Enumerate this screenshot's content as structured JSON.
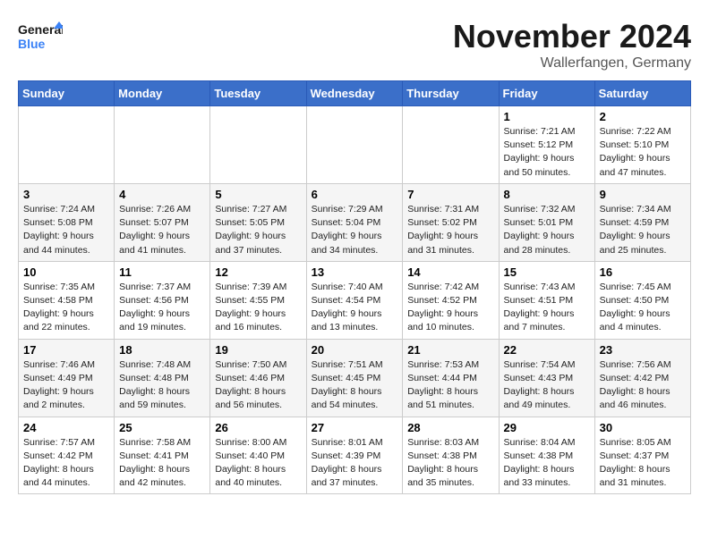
{
  "header": {
    "logo_line1": "General",
    "logo_line2": "Blue",
    "month": "November 2024",
    "location": "Wallerfangen, Germany"
  },
  "weekdays": [
    "Sunday",
    "Monday",
    "Tuesday",
    "Wednesday",
    "Thursday",
    "Friday",
    "Saturday"
  ],
  "weeks": [
    [
      {
        "day": "",
        "info": ""
      },
      {
        "day": "",
        "info": ""
      },
      {
        "day": "",
        "info": ""
      },
      {
        "day": "",
        "info": ""
      },
      {
        "day": "",
        "info": ""
      },
      {
        "day": "1",
        "info": "Sunrise: 7:21 AM\nSunset: 5:12 PM\nDaylight: 9 hours\nand 50 minutes."
      },
      {
        "day": "2",
        "info": "Sunrise: 7:22 AM\nSunset: 5:10 PM\nDaylight: 9 hours\nand 47 minutes."
      }
    ],
    [
      {
        "day": "3",
        "info": "Sunrise: 7:24 AM\nSunset: 5:08 PM\nDaylight: 9 hours\nand 44 minutes."
      },
      {
        "day": "4",
        "info": "Sunrise: 7:26 AM\nSunset: 5:07 PM\nDaylight: 9 hours\nand 41 minutes."
      },
      {
        "day": "5",
        "info": "Sunrise: 7:27 AM\nSunset: 5:05 PM\nDaylight: 9 hours\nand 37 minutes."
      },
      {
        "day": "6",
        "info": "Sunrise: 7:29 AM\nSunset: 5:04 PM\nDaylight: 9 hours\nand 34 minutes."
      },
      {
        "day": "7",
        "info": "Sunrise: 7:31 AM\nSunset: 5:02 PM\nDaylight: 9 hours\nand 31 minutes."
      },
      {
        "day": "8",
        "info": "Sunrise: 7:32 AM\nSunset: 5:01 PM\nDaylight: 9 hours\nand 28 minutes."
      },
      {
        "day": "9",
        "info": "Sunrise: 7:34 AM\nSunset: 4:59 PM\nDaylight: 9 hours\nand 25 minutes."
      }
    ],
    [
      {
        "day": "10",
        "info": "Sunrise: 7:35 AM\nSunset: 4:58 PM\nDaylight: 9 hours\nand 22 minutes."
      },
      {
        "day": "11",
        "info": "Sunrise: 7:37 AM\nSunset: 4:56 PM\nDaylight: 9 hours\nand 19 minutes."
      },
      {
        "day": "12",
        "info": "Sunrise: 7:39 AM\nSunset: 4:55 PM\nDaylight: 9 hours\nand 16 minutes."
      },
      {
        "day": "13",
        "info": "Sunrise: 7:40 AM\nSunset: 4:54 PM\nDaylight: 9 hours\nand 13 minutes."
      },
      {
        "day": "14",
        "info": "Sunrise: 7:42 AM\nSunset: 4:52 PM\nDaylight: 9 hours\nand 10 minutes."
      },
      {
        "day": "15",
        "info": "Sunrise: 7:43 AM\nSunset: 4:51 PM\nDaylight: 9 hours\nand 7 minutes."
      },
      {
        "day": "16",
        "info": "Sunrise: 7:45 AM\nSunset: 4:50 PM\nDaylight: 9 hours\nand 4 minutes."
      }
    ],
    [
      {
        "day": "17",
        "info": "Sunrise: 7:46 AM\nSunset: 4:49 PM\nDaylight: 9 hours\nand 2 minutes."
      },
      {
        "day": "18",
        "info": "Sunrise: 7:48 AM\nSunset: 4:48 PM\nDaylight: 8 hours\nand 59 minutes."
      },
      {
        "day": "19",
        "info": "Sunrise: 7:50 AM\nSunset: 4:46 PM\nDaylight: 8 hours\nand 56 minutes."
      },
      {
        "day": "20",
        "info": "Sunrise: 7:51 AM\nSunset: 4:45 PM\nDaylight: 8 hours\nand 54 minutes."
      },
      {
        "day": "21",
        "info": "Sunrise: 7:53 AM\nSunset: 4:44 PM\nDaylight: 8 hours\nand 51 minutes."
      },
      {
        "day": "22",
        "info": "Sunrise: 7:54 AM\nSunset: 4:43 PM\nDaylight: 8 hours\nand 49 minutes."
      },
      {
        "day": "23",
        "info": "Sunrise: 7:56 AM\nSunset: 4:42 PM\nDaylight: 8 hours\nand 46 minutes."
      }
    ],
    [
      {
        "day": "24",
        "info": "Sunrise: 7:57 AM\nSunset: 4:42 PM\nDaylight: 8 hours\nand 44 minutes."
      },
      {
        "day": "25",
        "info": "Sunrise: 7:58 AM\nSunset: 4:41 PM\nDaylight: 8 hours\nand 42 minutes."
      },
      {
        "day": "26",
        "info": "Sunrise: 8:00 AM\nSunset: 4:40 PM\nDaylight: 8 hours\nand 40 minutes."
      },
      {
        "day": "27",
        "info": "Sunrise: 8:01 AM\nSunset: 4:39 PM\nDaylight: 8 hours\nand 37 minutes."
      },
      {
        "day": "28",
        "info": "Sunrise: 8:03 AM\nSunset: 4:38 PM\nDaylight: 8 hours\nand 35 minutes."
      },
      {
        "day": "29",
        "info": "Sunrise: 8:04 AM\nSunset: 4:38 PM\nDaylight: 8 hours\nand 33 minutes."
      },
      {
        "day": "30",
        "info": "Sunrise: 8:05 AM\nSunset: 4:37 PM\nDaylight: 8 hours\nand 31 minutes."
      }
    ]
  ]
}
